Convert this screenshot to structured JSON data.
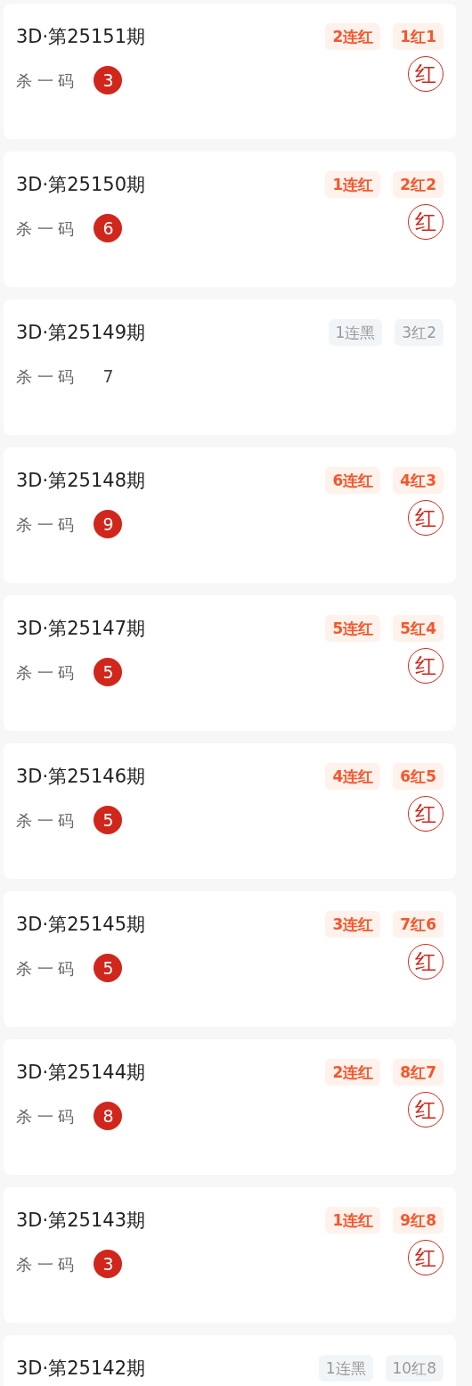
{
  "periods": [
    {
      "title": "3D·第25151期",
      "tags": [
        {
          "text": "2连红",
          "kind": "red"
        },
        {
          "text": "1红1",
          "kind": "red"
        }
      ],
      "label": "杀 一 码",
      "number": "3",
      "hit": true,
      "stamp": "红"
    },
    {
      "title": "3D·第25150期",
      "tags": [
        {
          "text": "1连红",
          "kind": "red"
        },
        {
          "text": "2红2",
          "kind": "red"
        }
      ],
      "label": "杀 一 码",
      "number": "6",
      "hit": true,
      "stamp": "红"
    },
    {
      "title": "3D·第25149期",
      "tags": [
        {
          "text": "1连黑",
          "kind": "grey"
        },
        {
          "text": "3红2",
          "kind": "grey"
        }
      ],
      "label": "杀 一 码",
      "number": "7",
      "hit": false
    },
    {
      "title": "3D·第25148期",
      "tags": [
        {
          "text": "6连红",
          "kind": "red"
        },
        {
          "text": "4红3",
          "kind": "red"
        }
      ],
      "label": "杀 一 码",
      "number": "9",
      "hit": true,
      "stamp": "红"
    },
    {
      "title": "3D·第25147期",
      "tags": [
        {
          "text": "5连红",
          "kind": "red"
        },
        {
          "text": "5红4",
          "kind": "red"
        }
      ],
      "label": "杀 一 码",
      "number": "5",
      "hit": true,
      "stamp": "红"
    },
    {
      "title": "3D·第25146期",
      "tags": [
        {
          "text": "4连红",
          "kind": "red"
        },
        {
          "text": "6红5",
          "kind": "red"
        }
      ],
      "label": "杀 一 码",
      "number": "5",
      "hit": true,
      "stamp": "红"
    },
    {
      "title": "3D·第25145期",
      "tags": [
        {
          "text": "3连红",
          "kind": "red"
        },
        {
          "text": "7红6",
          "kind": "red"
        }
      ],
      "label": "杀 一 码",
      "number": "5",
      "hit": true,
      "stamp": "红"
    },
    {
      "title": "3D·第25144期",
      "tags": [
        {
          "text": "2连红",
          "kind": "red"
        },
        {
          "text": "8红7",
          "kind": "red"
        }
      ],
      "label": "杀 一 码",
      "number": "8",
      "hit": true,
      "stamp": "红"
    },
    {
      "title": "3D·第25143期",
      "tags": [
        {
          "text": "1连红",
          "kind": "red"
        },
        {
          "text": "9红8",
          "kind": "red"
        }
      ],
      "label": "杀 一 码",
      "number": "3",
      "hit": true,
      "stamp": "红"
    },
    {
      "title": "3D·第25142期",
      "tags": [
        {
          "text": "1连黑",
          "kind": "grey"
        },
        {
          "text": "10红8",
          "kind": "grey"
        }
      ]
    }
  ]
}
